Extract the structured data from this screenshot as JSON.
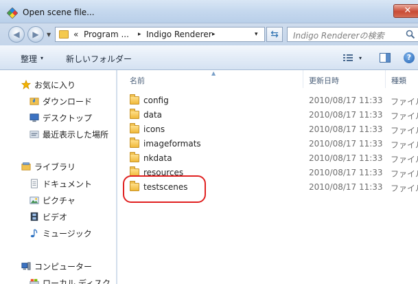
{
  "window": {
    "title": "Open scene file..."
  },
  "address": {
    "overflow": "«",
    "crumbs": [
      "Program ...",
      "Indigo Renderer"
    ],
    "separator": "▸",
    "dropdown": "▾"
  },
  "search": {
    "placeholder": "Indigo Rendererの検索"
  },
  "toolbar": {
    "organize": "整理",
    "organize_arrow": "▾",
    "new_folder": "新しいフォルダー",
    "views_arrow": "▾"
  },
  "sidebar": {
    "favorites": {
      "label": "お気に入り",
      "items": [
        "ダウンロード",
        "デスクトップ",
        "最近表示した場所"
      ]
    },
    "libraries": {
      "label": "ライブラリ",
      "items": [
        "ドキュメント",
        "ピクチャ",
        "ビデオ",
        "ミュージック"
      ]
    },
    "computer": {
      "label": "コンピューター",
      "items": [
        "ローカル ディスク"
      ]
    }
  },
  "columns": {
    "name": "名前",
    "date": "更新日時",
    "type": "種類"
  },
  "files": [
    {
      "name": "config",
      "date": "2010/08/17 11:33",
      "type": "ファイル"
    },
    {
      "name": "data",
      "date": "2010/08/17 11:33",
      "type": "ファイル"
    },
    {
      "name": "icons",
      "date": "2010/08/17 11:33",
      "type": "ファイル"
    },
    {
      "name": "imageformats",
      "date": "2010/08/17 11:33",
      "type": "ファイル"
    },
    {
      "name": "nkdata",
      "date": "2010/08/17 11:33",
      "type": "ファイル"
    },
    {
      "name": "resources",
      "date": "2010/08/17 11:33",
      "type": "ファイル"
    },
    {
      "name": "testscenes",
      "date": "2010/08/17 11:33",
      "type": "ファイル"
    }
  ],
  "highlight": {
    "color": "#e02020",
    "target": "testscenes"
  }
}
